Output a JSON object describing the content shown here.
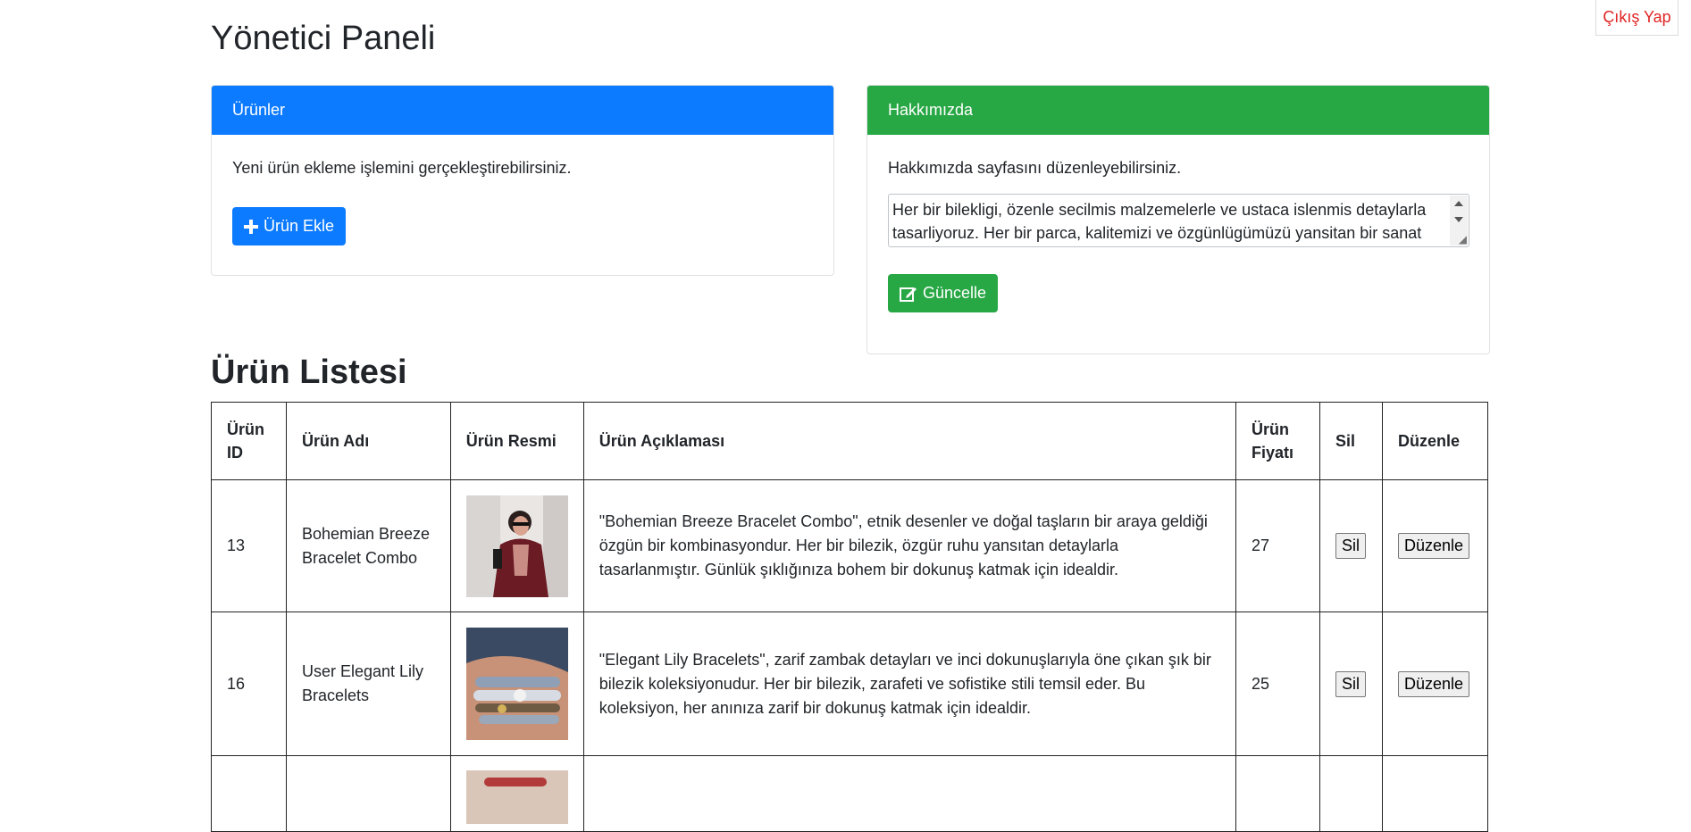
{
  "header": {
    "logout_label": "Çıkış Yap",
    "page_title": "Yönetici Paneli"
  },
  "products_card": {
    "title": "Ürünler",
    "text": "Yeni ürün ekleme işlemini gerçekleştirebilirsiniz.",
    "add_button": "Ürün Ekle",
    "color": "#0d7bff"
  },
  "about_card": {
    "title": "Hakkımızda",
    "text": "Hakkımızda sayfasını düzenleyebilirsiniz.",
    "textarea_value": "Her bir bilekligi, özenle secilmis malzemelerle ve ustaca islenmis detaylarla tasarliyoruz. Her bir parca, kalitemizi ve özgünlügümüzü yansitan bir sanat",
    "update_button": "Güncelle",
    "color": "#28a745"
  },
  "list": {
    "title": "Ürün Listesi",
    "columns": [
      "Ürün ID",
      "Ürün Adı",
      "Ürün Resmi",
      "Ürün Açıklaması",
      "Ürün Fiyatı",
      "Sil",
      "Düzenle"
    ],
    "rows": [
      {
        "id": "13",
        "name": "Bohemian Breeze Bracelet Combo",
        "description": "\"Bohemian Breeze Bracelet Combo\", etnik desenler ve doğal taşların bir araya geldiği özgün bir kombinasyondur. Her bir bilezik, özgür ruhu yansıtan detaylarla tasarlanmıştır. Günlük şıklığınıza bohem bir dokunuş katmak için idealdir.",
        "price": "27",
        "delete_label": "Sil",
        "edit_label": "Düzenle"
      },
      {
        "id": "16",
        "name": "User Elegant Lily Bracelets",
        "description": "\"Elegant Lily Bracelets\", zarif zambak detayları ve inci dokunuşlarıyla öne çıkan şık bir bilezik koleksiyonudur. Her bir bilezik, zarafeti ve sofistike stili temsil eder. Bu koleksiyon, her anınıza zarif bir dokunuş katmak için idealdir.",
        "price": "25",
        "delete_label": "Sil",
        "edit_label": "Düzenle"
      }
    ]
  }
}
